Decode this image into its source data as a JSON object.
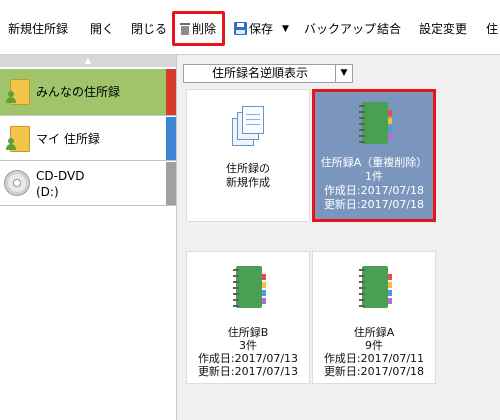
{
  "toolbar": {
    "new": "新規住所録",
    "open": "開く",
    "close": "閉じる",
    "delete": "削除",
    "save": "保存",
    "backup": "バックアップ",
    "merge": "結合",
    "settings": "設定変更",
    "overflow": "住"
  },
  "sidebar": {
    "items": [
      {
        "label": "みんなの住所録",
        "selected": true
      },
      {
        "label": "マイ 住所録"
      },
      {
        "label_line1": "CD-DVD",
        "label_line2": "(D:)"
      }
    ]
  },
  "main": {
    "sort": {
      "value": "住所録名逆順表示"
    },
    "cards": [
      {
        "line1": "住所録の",
        "line2": "新規作成"
      },
      {
        "name": "住所録A（重複削除）",
        "count": "1件",
        "created": "作成日:2017/07/18",
        "updated": "更新日:2017/07/18",
        "selected": true
      },
      {
        "name": "住所録B",
        "count": "3件",
        "created": "作成日:2017/07/13",
        "updated": "更新日:2017/07/13"
      },
      {
        "name": "住所録A",
        "count": "9件",
        "created": "作成日:2017/07/11",
        "updated": "更新日:2017/07/18"
      }
    ]
  },
  "colors": {
    "highlight": "#e8141a",
    "selected_card": "#7b96bd",
    "selected_sidebar": "#9fc46a",
    "notebook": "#4aa052"
  }
}
